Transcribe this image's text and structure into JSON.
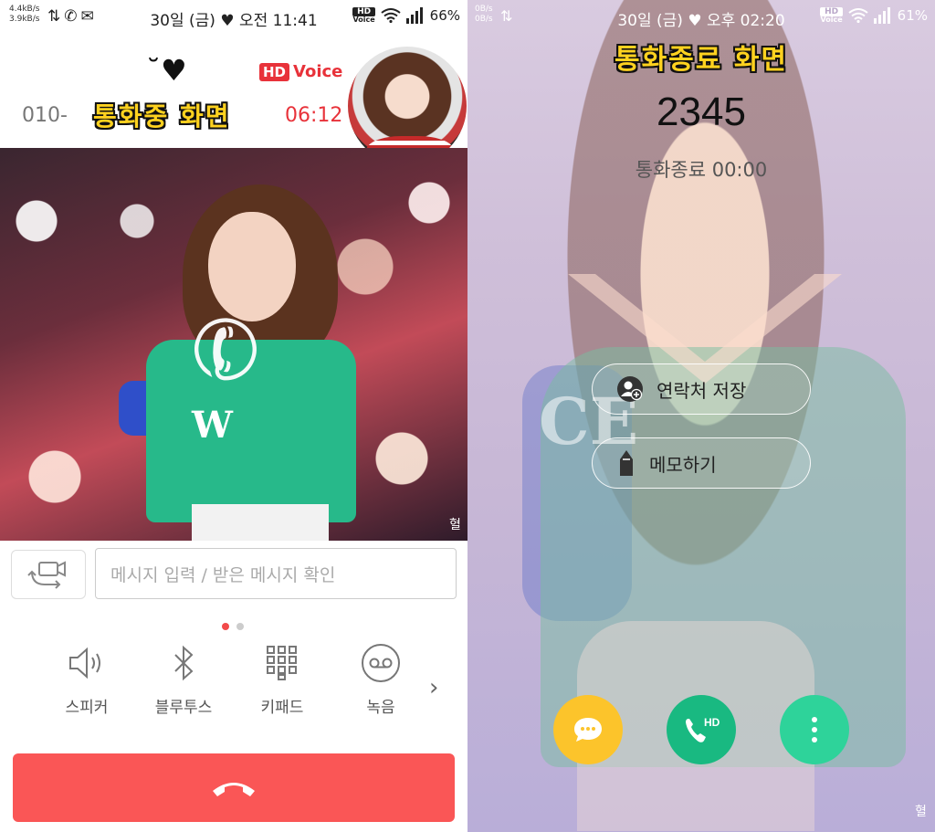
{
  "left_screen": {
    "status_bar": {
      "speed_up": "4.4kB/s",
      "speed_down": "3.9kB/s",
      "datetime": "30일 (금) ♥ 오전 11:41",
      "battery": "66%",
      "hd_top": "HD",
      "hd_bottom": "Voice"
    },
    "decoration": "˘♥",
    "hd_voice": {
      "badge": "HD",
      "text": "Voice"
    },
    "caller_number": "010-",
    "caption": "통화중 화면",
    "call_timer": "06:12",
    "signature": "혈",
    "message_input": {
      "placeholder": "메시지 입력 / 받은 메시지 확인"
    },
    "controls": [
      {
        "label": "스피커",
        "icon": "speaker-icon"
      },
      {
        "label": "블루투스",
        "icon": "bluetooth-icon"
      },
      {
        "label": "키패드",
        "icon": "keypad-icon"
      },
      {
        "label": "녹음",
        "icon": "record-icon"
      }
    ],
    "page_indicator": {
      "pages": 2,
      "active": 0
    },
    "end_call_icon": "hang-up-icon"
  },
  "right_screen": {
    "status_bar": {
      "speed_up": "0B/s",
      "speed_down": "0B/s",
      "datetime": "30일 (금) ♥ 오후 02:20",
      "battery": "61%",
      "hd_top": "HD",
      "hd_bottom": "Voice"
    },
    "caption": "통화종료 화면",
    "number": "2345",
    "status": "통화종료 00:00",
    "letters": "CE",
    "signature": "혈",
    "actions": [
      {
        "label": "연락처 저장",
        "icon": "add-contact-icon"
      },
      {
        "label": "메모하기",
        "icon": "pencil-icon"
      }
    ],
    "fabs": {
      "message_icon": "chat-bubble-icon",
      "call_badge": "HD",
      "more_icon": "more-vertical-icon"
    }
  },
  "colors": {
    "accent_red": "#fa5656",
    "hd_red": "#e8323a",
    "caption_yellow": "#ffd21f",
    "msg_yellow": "#fcc42b",
    "call_green": "#19b981",
    "more_green": "#2ed39a"
  }
}
